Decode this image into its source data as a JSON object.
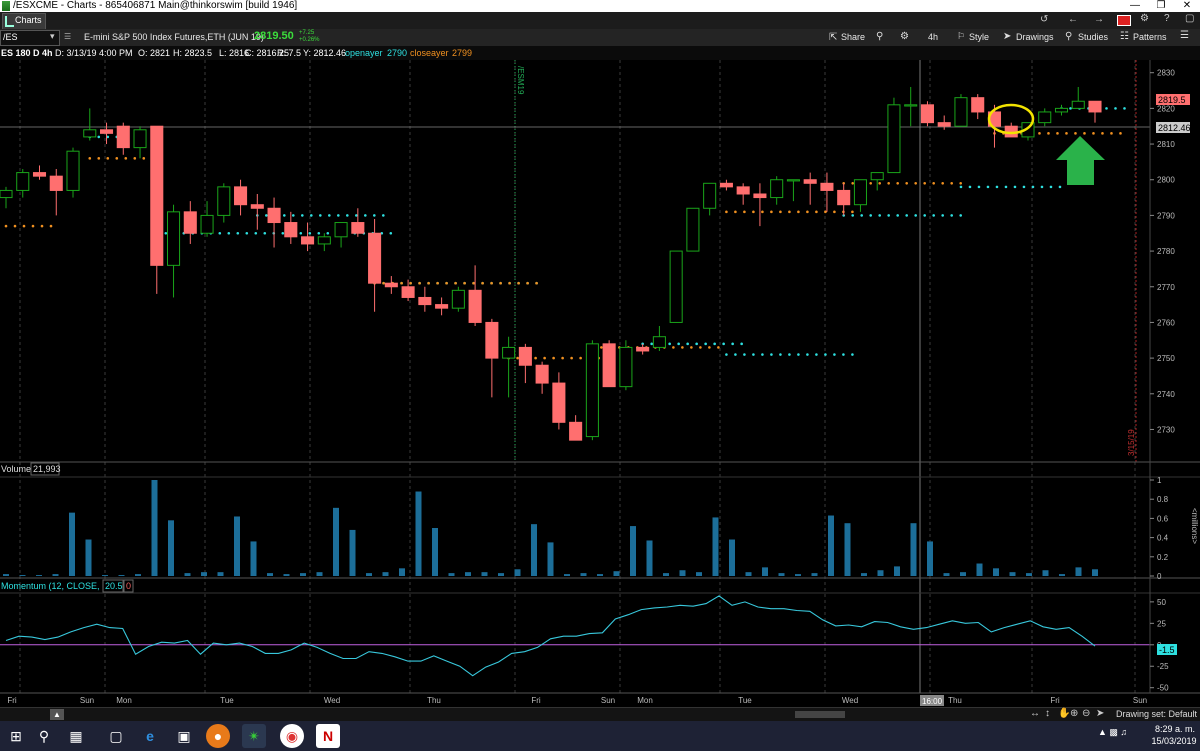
{
  "window": {
    "title": "/ESXCME - Charts - 865406871 Main@thinkorswim [build 1946]"
  },
  "tab": {
    "label": "Charts"
  },
  "toolbar": {
    "symbol": "/ES",
    "description": "E-mini S&P 500 Index Futures,ETH (JUN 19)",
    "last_price": "2819.50",
    "change": "+7.25",
    "change_pct": "+0.26%",
    "share": "Share",
    "timeframe": "4h",
    "style": "Style",
    "drawings": "Drawings",
    "studies": "Studies",
    "patterns": "Patterns"
  },
  "infobar": {
    "aggregation": "ES 180 D 4h",
    "date": "D: 3/13/19 4:00 PM",
    "open": "O: 2821",
    "high": "H: 2823.5",
    "low": "L: 2816",
    "close": "C: 2816.25",
    "range": "R: 7.5",
    "y": "Y: 2812.46",
    "openayer_label": "openayer",
    "openayer_value": "2790",
    "closeayer_label": "closeayer",
    "closeayer_value": "2799"
  },
  "price_panel": {
    "price_badge": "2819.5",
    "y_badge": "2812.46",
    "contract_label": "/ESM19",
    "expiry_label": "3/15/19",
    "axis_ticks": [
      "2830",
      "2820",
      "2810",
      "2800",
      "2790",
      "2780",
      "2770",
      "2760",
      "2750",
      "2740",
      "2730"
    ]
  },
  "volume_panel": {
    "label": "Volume",
    "value": "21,993",
    "axis_ticks": [
      "1",
      "0.8",
      "0.6",
      "0.4",
      "0.2",
      "0"
    ],
    "unit": "<millions>"
  },
  "momentum_panel": {
    "label": "Momentum (12, CLOSE, no)",
    "value": "20.5",
    "second_value": "0",
    "axis_ticks": [
      "50",
      "25",
      "0",
      "-25",
      "-50"
    ],
    "badge": "-1.5"
  },
  "x_axis": {
    "labels": [
      {
        "t": "Fri"
      },
      {
        "t": "Sun"
      },
      {
        "t": "Mon"
      },
      {
        "t": "Tue"
      },
      {
        "t": "Wed"
      },
      {
        "t": "Thu"
      },
      {
        "t": "Fri"
      },
      {
        "t": "Sun"
      },
      {
        "t": "Mon"
      },
      {
        "t": "Tue"
      },
      {
        "t": "Wed"
      },
      {
        "t": "16:00"
      },
      {
        "t": "Thu"
      },
      {
        "t": "Fri"
      },
      {
        "t": "Sun"
      }
    ]
  },
  "bottom": {
    "drawing_set": "Drawing set: Default"
  },
  "taskbar": {
    "time": "8:29 a. m.",
    "date": "15/03/2019"
  },
  "colors": {
    "up": "#1aa51a",
    "down": "#ff6f6f",
    "cyan": "#2ee0e0",
    "orange": "#f09020",
    "volume": "#1c6e99",
    "momentum": "#38c8dc",
    "zero_line": "#c060e0",
    "arrow": "#2ab24a",
    "highlight": "#f2e300"
  },
  "chart_data": [
    {
      "type": "candlestick",
      "title": "E-mini S&P 500 Index Futures,ETH (JUN 19)",
      "ylim": [
        2722,
        2833
      ],
      "candles": [
        [
          2795,
          2798,
          2792,
          2797
        ],
        [
          2797,
          2803,
          2795,
          2802
        ],
        [
          2802,
          2804,
          2800,
          2801
        ],
        [
          2801,
          2803,
          2790,
          2797
        ],
        [
          2797,
          2809,
          2795,
          2808
        ],
        [
          2812,
          2820,
          2811,
          2814
        ],
        [
          2814,
          2816,
          2810,
          2813
        ],
        [
          2815,
          2816,
          2807,
          2809
        ],
        [
          2809,
          2815,
          2806,
          2814
        ],
        [
          2815,
          2815,
          2768,
          2776
        ],
        [
          2776,
          2793,
          2767,
          2791
        ],
        [
          2791,
          2794,
          2782,
          2785
        ],
        [
          2785,
          2794,
          2784,
          2790
        ],
        [
          2790,
          2799,
          2788,
          2798
        ],
        [
          2798,
          2800,
          2790,
          2793
        ],
        [
          2793,
          2796,
          2786,
          2792
        ],
        [
          2792,
          2795,
          2781,
          2788
        ],
        [
          2788,
          2791,
          2782,
          2784
        ],
        [
          2784,
          2788,
          2780,
          2782
        ],
        [
          2782,
          2785,
          2780,
          2784
        ],
        [
          2784,
          2788,
          2781,
          2788
        ],
        [
          2788,
          2792,
          2784,
          2785
        ],
        [
          2785,
          2789,
          2763,
          2771
        ],
        [
          2771,
          2773,
          2768,
          2770
        ],
        [
          2770,
          2772,
          2766,
          2767
        ],
        [
          2767,
          2770,
          2763,
          2765
        ],
        [
          2765,
          2767,
          2762,
          2764
        ],
        [
          2764,
          2770,
          2763,
          2769
        ],
        [
          2769,
          2776,
          2759,
          2760
        ],
        [
          2760,
          2761,
          2739,
          2750
        ],
        [
          2750,
          2756,
          2739,
          2753
        ],
        [
          2753,
          2754,
          2743,
          2748
        ],
        [
          2748,
          2749,
          2740,
          2743
        ],
        [
          2743,
          2746,
          2730,
          2732
        ],
        [
          2732,
          2734,
          2727,
          2727
        ],
        [
          2728,
          2755,
          2727,
          2754
        ],
        [
          2754,
          2755,
          2742,
          2742
        ],
        [
          2742,
          2755,
          2741,
          2753
        ],
        [
          2753,
          2754,
          2751,
          2752
        ],
        [
          2753,
          2759,
          2752,
          2756
        ],
        [
          2760,
          2780,
          2760,
          2780
        ],
        [
          2780,
          2792,
          2780,
          2792
        ],
        [
          2792,
          2799,
          2790,
          2799
        ],
        [
          2799,
          2800,
          2797,
          2798
        ],
        [
          2798,
          2799,
          2793,
          2796
        ],
        [
          2796,
          2799,
          2787,
          2795
        ],
        [
          2795,
          2801,
          2793,
          2800
        ],
        [
          2800,
          2800,
          2794,
          2800
        ],
        [
          2800,
          2802,
          2793,
          2799
        ],
        [
          2799,
          2802,
          2791,
          2797
        ],
        [
          2797,
          2799,
          2790,
          2793
        ],
        [
          2793,
          2800,
          2791,
          2800
        ],
        [
          2800,
          2802,
          2797,
          2802
        ],
        [
          2802,
          2823,
          2802,
          2821
        ],
        [
          2821,
          2826,
          2815,
          2821
        ],
        [
          2821,
          2822,
          2815,
          2816
        ],
        [
          2816,
          2818,
          2814,
          2815
        ],
        [
          2815,
          2824,
          2815,
          2823
        ],
        [
          2823,
          2824,
          2817,
          2819
        ],
        [
          2819,
          2821,
          2809,
          2815
        ],
        [
          2815,
          2816,
          2812,
          2812
        ],
        [
          2812,
          2816,
          2811,
          2816
        ],
        [
          2816,
          2820,
          2815,
          2819
        ],
        [
          2819,
          2821,
          2818,
          2820
        ],
        [
          2820,
          2826,
          2820,
          2822
        ],
        [
          2822,
          2822,
          2816,
          2819
        ]
      ],
      "overlays": [
        {
          "name": "openayer",
          "color": "cyan",
          "segments": [
            [
              5,
              9,
              2812
            ],
            [
              9,
              23,
              2785
            ],
            [
              15,
              23,
              2790
            ],
            [
              22,
              32,
              2771
            ],
            [
              38,
              44,
              2754
            ],
            [
              43,
              51,
              2751
            ],
            [
              50,
              57,
              2790
            ],
            [
              57,
              63,
              2798
            ],
            [
              63,
              67,
              2820
            ]
          ]
        },
        {
          "name": "closeayer",
          "color": "orange",
          "segments": [
            [
              0,
              3,
              2787
            ],
            [
              5,
              9,
              2806
            ],
            [
              22,
              32,
              2771
            ],
            [
              30,
              36,
              2750
            ],
            [
              35,
              43,
              2753
            ],
            [
              43,
              51,
              2791
            ],
            [
              50,
              57,
              2799
            ],
            [
              59,
              67,
              2813
            ]
          ]
        }
      ]
    },
    {
      "type": "bar",
      "title": "Volume",
      "ylim": [
        0,
        1
      ],
      "values": [
        0.02,
        0.01,
        0.01,
        0.02,
        0.66,
        0.38,
        0.01,
        0.01,
        0.02,
        1.0,
        0.58,
        0.03,
        0.04,
        0.04,
        0.62,
        0.36,
        0.03,
        0.02,
        0.03,
        0.04,
        0.71,
        0.48,
        0.03,
        0.04,
        0.08,
        0.88,
        0.5,
        0.03,
        0.04,
        0.04,
        0.03,
        0.07,
        0.54,
        0.35,
        0.02,
        0.03,
        0.02,
        0.05,
        0.52,
        0.37,
        0.03,
        0.06,
        0.04,
        0.61,
        0.38,
        0.04,
        0.09,
        0.03,
        0.02,
        0.03,
        0.63,
        0.55,
        0.03,
        0.06,
        0.1,
        0.55,
        0.36,
        0.03,
        0.04,
        0.13,
        0.08,
        0.04,
        0.03,
        0.06,
        0.02,
        0.09,
        0.07
      ]
    },
    {
      "type": "line",
      "title": "Momentum (12, CLOSE, no)",
      "ylim": [
        -55,
        58
      ],
      "values": [
        5,
        10,
        9,
        6,
        9,
        15,
        20,
        24,
        20,
        19,
        -11,
        -2,
        3,
        2,
        5,
        -11,
        2,
        0,
        2,
        -2,
        -10,
        -10,
        -6,
        2,
        -3,
        -10,
        -16,
        -16,
        -8,
        -10,
        -14,
        -19,
        -19,
        -13,
        -19,
        -25,
        -36,
        -26,
        -20,
        -10,
        -8,
        -3,
        7,
        10,
        10,
        13,
        14,
        30,
        35,
        41,
        43,
        44,
        46,
        45,
        48,
        57,
        46,
        50,
        44,
        42,
        42,
        40,
        39,
        29,
        22,
        23,
        21,
        27,
        26,
        21,
        18,
        20,
        24,
        28,
        25,
        26,
        15,
        20,
        24,
        28,
        21,
        18,
        20,
        10,
        -1.5
      ]
    }
  ]
}
